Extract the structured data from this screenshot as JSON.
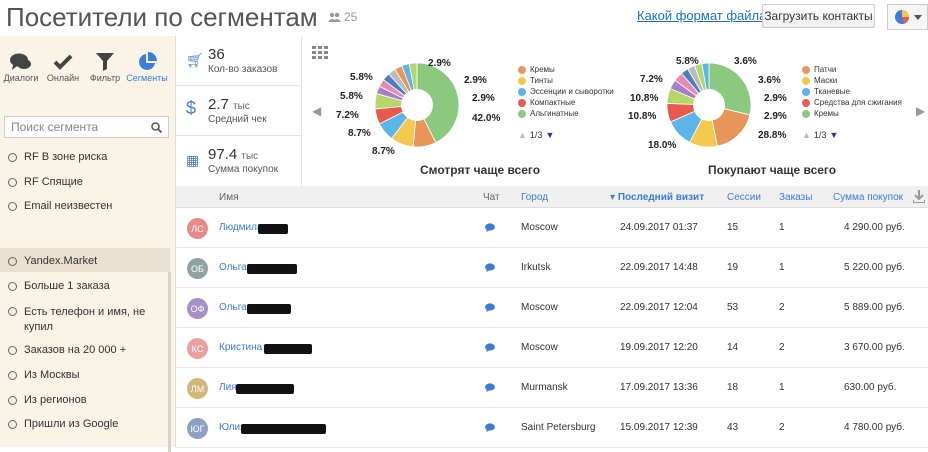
{
  "header": {
    "title": "Посетители по сегментам",
    "users_count": "25",
    "format_link": "Какой формат файла?",
    "upload_button": "Загрузить контакты"
  },
  "sidebar": {
    "nav": [
      {
        "label": "Диалоги",
        "icon": "chat-icon"
      },
      {
        "label": "Онлайн",
        "icon": "check-icon"
      },
      {
        "label": "Фильтр",
        "icon": "filter-icon"
      },
      {
        "label": "Сегменты",
        "icon": "pie-chart-icon"
      }
    ],
    "search_placeholder": "Поиск сегмента",
    "segments": [
      "RF В зоне риска",
      "RF Спящие",
      "Email неизвестен",
      "Yandex.Market",
      "Больше 1 заказа",
      "Есть телефон и имя, не купил",
      "Заказов на 20 000 +",
      "Из Москвы",
      "Из регионов",
      "Пришли из Google"
    ]
  },
  "stats": [
    {
      "value": "36",
      "unit": "",
      "label": "Кол-во заказов",
      "icon": "cart-icon"
    },
    {
      "value": "2.7",
      "unit": "тыс",
      "label": "Средний чек",
      "icon": "dollar-icon"
    },
    {
      "value": "97.4",
      "unit": "тыс",
      "label": "Сумма покупок",
      "icon": "calculator-icon"
    }
  ],
  "charts": {
    "left": {
      "title": "Смотрят чаще всего",
      "legend": [
        "Кремы",
        "Тинты",
        "Эссенции и сыворотки",
        "Компактные",
        "Альгинатные"
      ],
      "pager": "1/3",
      "labels": [
        "2.9%",
        "2.9%",
        "2.9%",
        "42.0%",
        "5.8%",
        "5.8%",
        "7.2%",
        "8.7%",
        "8.7%"
      ]
    },
    "right": {
      "title": "Покупают чаще всего",
      "legend": [
        "Патчи",
        "Маски",
        "Тканевые",
        "Средства для сжигания",
        "Кремы"
      ],
      "pager": "1/3",
      "labels": [
        "5.8%",
        "3.6%",
        "3.6%",
        "2.9%",
        "2.9%",
        "28.8%",
        "7.2%",
        "10.8%",
        "10.8%",
        "18.0%"
      ]
    }
  },
  "colors": {
    "blue": "#4a7fc1",
    "green": "#8bc97f",
    "orange": "#e8955a",
    "yellow": "#f2c94c",
    "lightblue": "#5bb5e8",
    "red": "#e85a4f",
    "purple": "#a77fc7",
    "pink": "#e88ab0",
    "lime": "#b5d66b",
    "grey": "#bbb"
  },
  "table": {
    "headers": {
      "name": "Имя",
      "chat": "Чат",
      "city": "Город",
      "last_visit": "Последний визит",
      "sessions": "Сессии",
      "orders": "Заказы",
      "sum": "Сумма покупок"
    },
    "rows": [
      {
        "initials": "ЛС",
        "color": "#e88a8a",
        "name": "Людмила",
        "city": "Moscow",
        "visit": "24.09.2017 01:37",
        "sessions": "15",
        "orders": "1",
        "sum": "4 290.00 руб."
      },
      {
        "initials": "ОБ",
        "color": "#8fa3a3",
        "name": "Ольга",
        "city": "Irkutsk",
        "visit": "22.09.2017 14:48",
        "sessions": "19",
        "orders": "1",
        "sum": "5 220.00 руб."
      },
      {
        "initials": "ОФ",
        "color": "#a98fc7",
        "name": "Ольга",
        "city": "Moscow",
        "visit": "22.09.2017 12:04",
        "sessions": "53",
        "orders": "2",
        "sum": "5 889.00 руб."
      },
      {
        "initials": "КС",
        "color": "#e8a0a0",
        "name": "Кристина",
        "city": "Moscow",
        "visit": "19.09.2017 12:20",
        "sessions": "14",
        "orders": "2",
        "sum": "3 670.00 руб."
      },
      {
        "initials": "ЛМ",
        "color": "#d4b57a",
        "name": "Лия",
        "city": "Murmansk",
        "visit": "17.09.2017 13:36",
        "sessions": "18",
        "orders": "1",
        "sum": "630.00 руб."
      },
      {
        "initials": "ЮГ",
        "color": "#8fa0c7",
        "name": "Юлия",
        "city": "Saint Petersburg",
        "visit": "15.09.2017 12:39",
        "sessions": "43",
        "orders": "2",
        "sum": "4 780.00 руб."
      }
    ]
  }
}
